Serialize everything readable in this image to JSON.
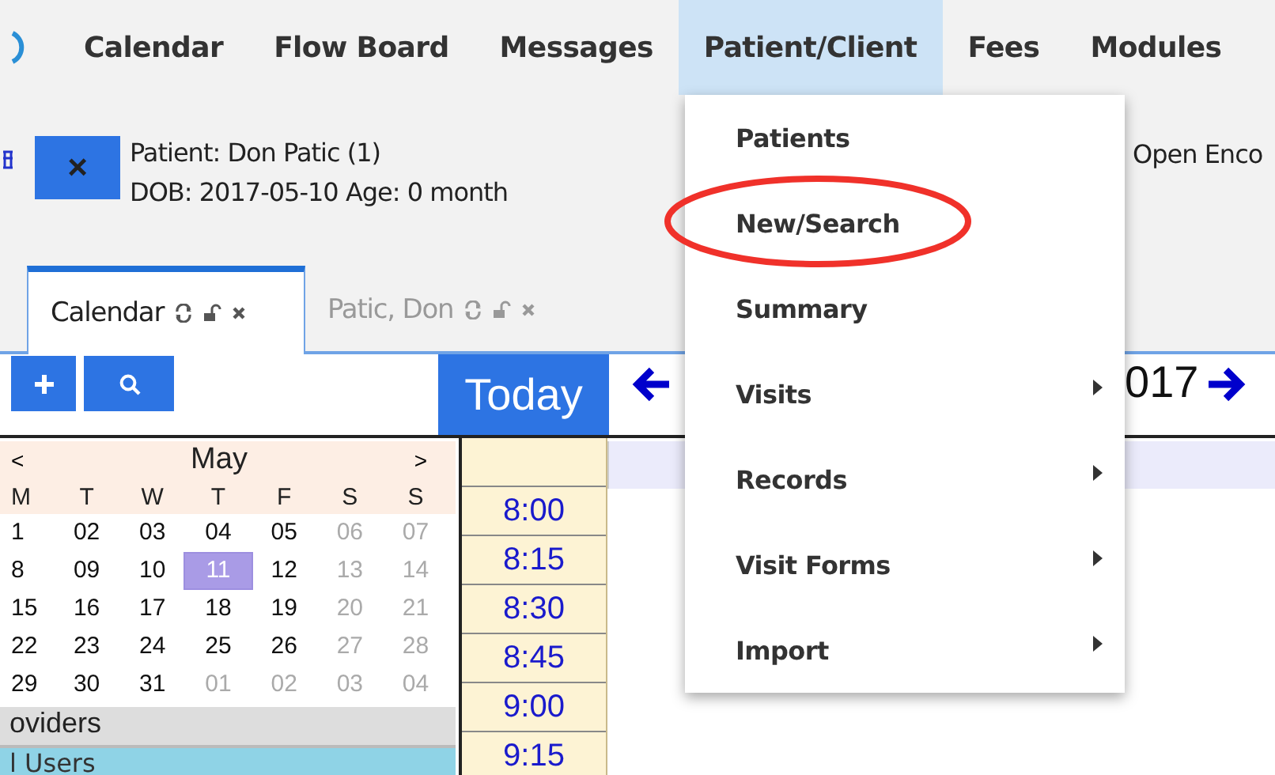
{
  "nav": {
    "items": [
      {
        "label": "Calendar",
        "selected": false
      },
      {
        "label": "Flow Board",
        "selected": false
      },
      {
        "label": "Messages",
        "selected": false
      },
      {
        "label": "Patient/Client",
        "selected": true
      },
      {
        "label": "Fees",
        "selected": false
      },
      {
        "label": "Modules",
        "selected": false
      }
    ]
  },
  "patient": {
    "name_line": "Patient: Don Patic (1)",
    "dob_line": "DOB: 2017-05-10 Age: 0 month",
    "close": "×"
  },
  "open_encounter": "Open Enco",
  "tabs": [
    {
      "label": "Calendar",
      "selected": true
    },
    {
      "label": "Patic, Don",
      "selected": false
    }
  ],
  "toolbar": {
    "today": "Today",
    "date_fragment": "017"
  },
  "mini_calendar": {
    "prev": "<",
    "month": "May",
    "next": ">",
    "weekdays": [
      "M",
      "T",
      "W",
      "T",
      "F",
      "S",
      "S"
    ],
    "weeks": [
      [
        {
          "day": "1",
          "muted": false,
          "selected": false
        },
        {
          "day": "02",
          "muted": false,
          "selected": false
        },
        {
          "day": "03",
          "muted": false,
          "selected": false
        },
        {
          "day": "04",
          "muted": false,
          "selected": false
        },
        {
          "day": "05",
          "muted": false,
          "selected": false
        },
        {
          "day": "06",
          "muted": true,
          "selected": false
        },
        {
          "day": "07",
          "muted": true,
          "selected": false
        }
      ],
      [
        {
          "day": "8",
          "muted": false,
          "selected": false
        },
        {
          "day": "09",
          "muted": false,
          "selected": false
        },
        {
          "day": "10",
          "muted": false,
          "selected": false
        },
        {
          "day": "11",
          "muted": false,
          "selected": true
        },
        {
          "day": "12",
          "muted": false,
          "selected": false
        },
        {
          "day": "13",
          "muted": true,
          "selected": false
        },
        {
          "day": "14",
          "muted": true,
          "selected": false
        }
      ],
      [
        {
          "day": "15",
          "muted": false,
          "selected": false
        },
        {
          "day": "16",
          "muted": false,
          "selected": false
        },
        {
          "day": "17",
          "muted": false,
          "selected": false
        },
        {
          "day": "18",
          "muted": false,
          "selected": false
        },
        {
          "day": "19",
          "muted": false,
          "selected": false
        },
        {
          "day": "20",
          "muted": true,
          "selected": false
        },
        {
          "day": "21",
          "muted": true,
          "selected": false
        }
      ],
      [
        {
          "day": "22",
          "muted": false,
          "selected": false
        },
        {
          "day": "23",
          "muted": false,
          "selected": false
        },
        {
          "day": "24",
          "muted": false,
          "selected": false
        },
        {
          "day": "25",
          "muted": false,
          "selected": false
        },
        {
          "day": "26",
          "muted": false,
          "selected": false
        },
        {
          "day": "27",
          "muted": true,
          "selected": false
        },
        {
          "day": "28",
          "muted": true,
          "selected": false
        }
      ],
      [
        {
          "day": "29",
          "muted": false,
          "selected": false
        },
        {
          "day": "30",
          "muted": false,
          "selected": false
        },
        {
          "day": "31",
          "muted": false,
          "selected": false
        },
        {
          "day": "01",
          "muted": true,
          "selected": false
        },
        {
          "day": "02",
          "muted": true,
          "selected": false
        },
        {
          "day": "03",
          "muted": true,
          "selected": false
        },
        {
          "day": "04",
          "muted": true,
          "selected": false
        }
      ]
    ]
  },
  "providers": {
    "header": "oviders",
    "items": [
      {
        "label": "l Users",
        "selected": true
      }
    ]
  },
  "times": [
    "8:00",
    "8:15",
    "8:30",
    "8:45",
    "9:00",
    "9:15"
  ],
  "menu": {
    "items": [
      {
        "label": "Patients",
        "has_submenu": false
      },
      {
        "label": "New/Search",
        "has_submenu": false
      },
      {
        "label": "Summary",
        "has_submenu": false
      },
      {
        "label": "Visits",
        "has_submenu": true
      },
      {
        "label": "Records",
        "has_submenu": true
      },
      {
        "label": "Visit Forms",
        "has_submenu": true
      },
      {
        "label": "Import",
        "has_submenu": true
      }
    ]
  }
}
